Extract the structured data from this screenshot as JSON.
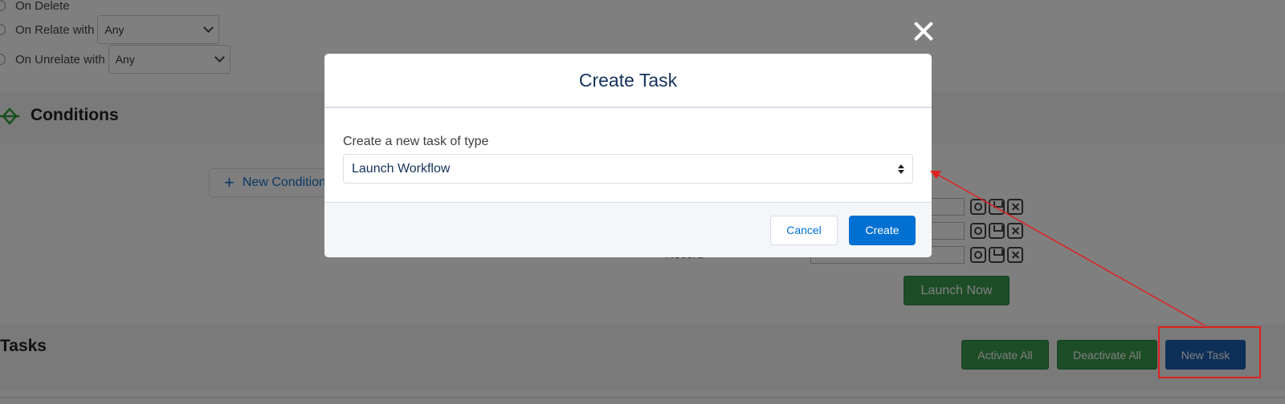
{
  "background": {
    "triggers": {
      "on_delete_label": "On Delete",
      "on_relate_label": "On Relate with",
      "on_relate_value": "Any",
      "on_unrelate_label": "On Unrelate with",
      "on_unrelate_value": "Any"
    },
    "conditions": {
      "title": "Conditions",
      "new_condition_label": "New Condition"
    },
    "record_label": "Record",
    "launch_now_label": "Launch Now",
    "tasks": {
      "title": "Tasks",
      "activate_all_label": "Activate All",
      "deactivate_all_label": "Deactivate All",
      "new_task_label": "New Task"
    }
  },
  "modal": {
    "title": "Create Task",
    "field_label": "Create a new task of type",
    "selected_type": "Launch Workflow",
    "cancel_label": "Cancel",
    "create_label": "Create"
  },
  "colors": {
    "overlay": "#000000",
    "primary_blue": "#0070d2",
    "green": "#3a9a4d",
    "annotation_red": "#e02020"
  },
  "icons": [
    "close-icon",
    "conditions-icon",
    "plus-icon",
    "circle-icon",
    "save-icon",
    "x-icon",
    "select-updown-icon",
    "annotation-arrow"
  ]
}
